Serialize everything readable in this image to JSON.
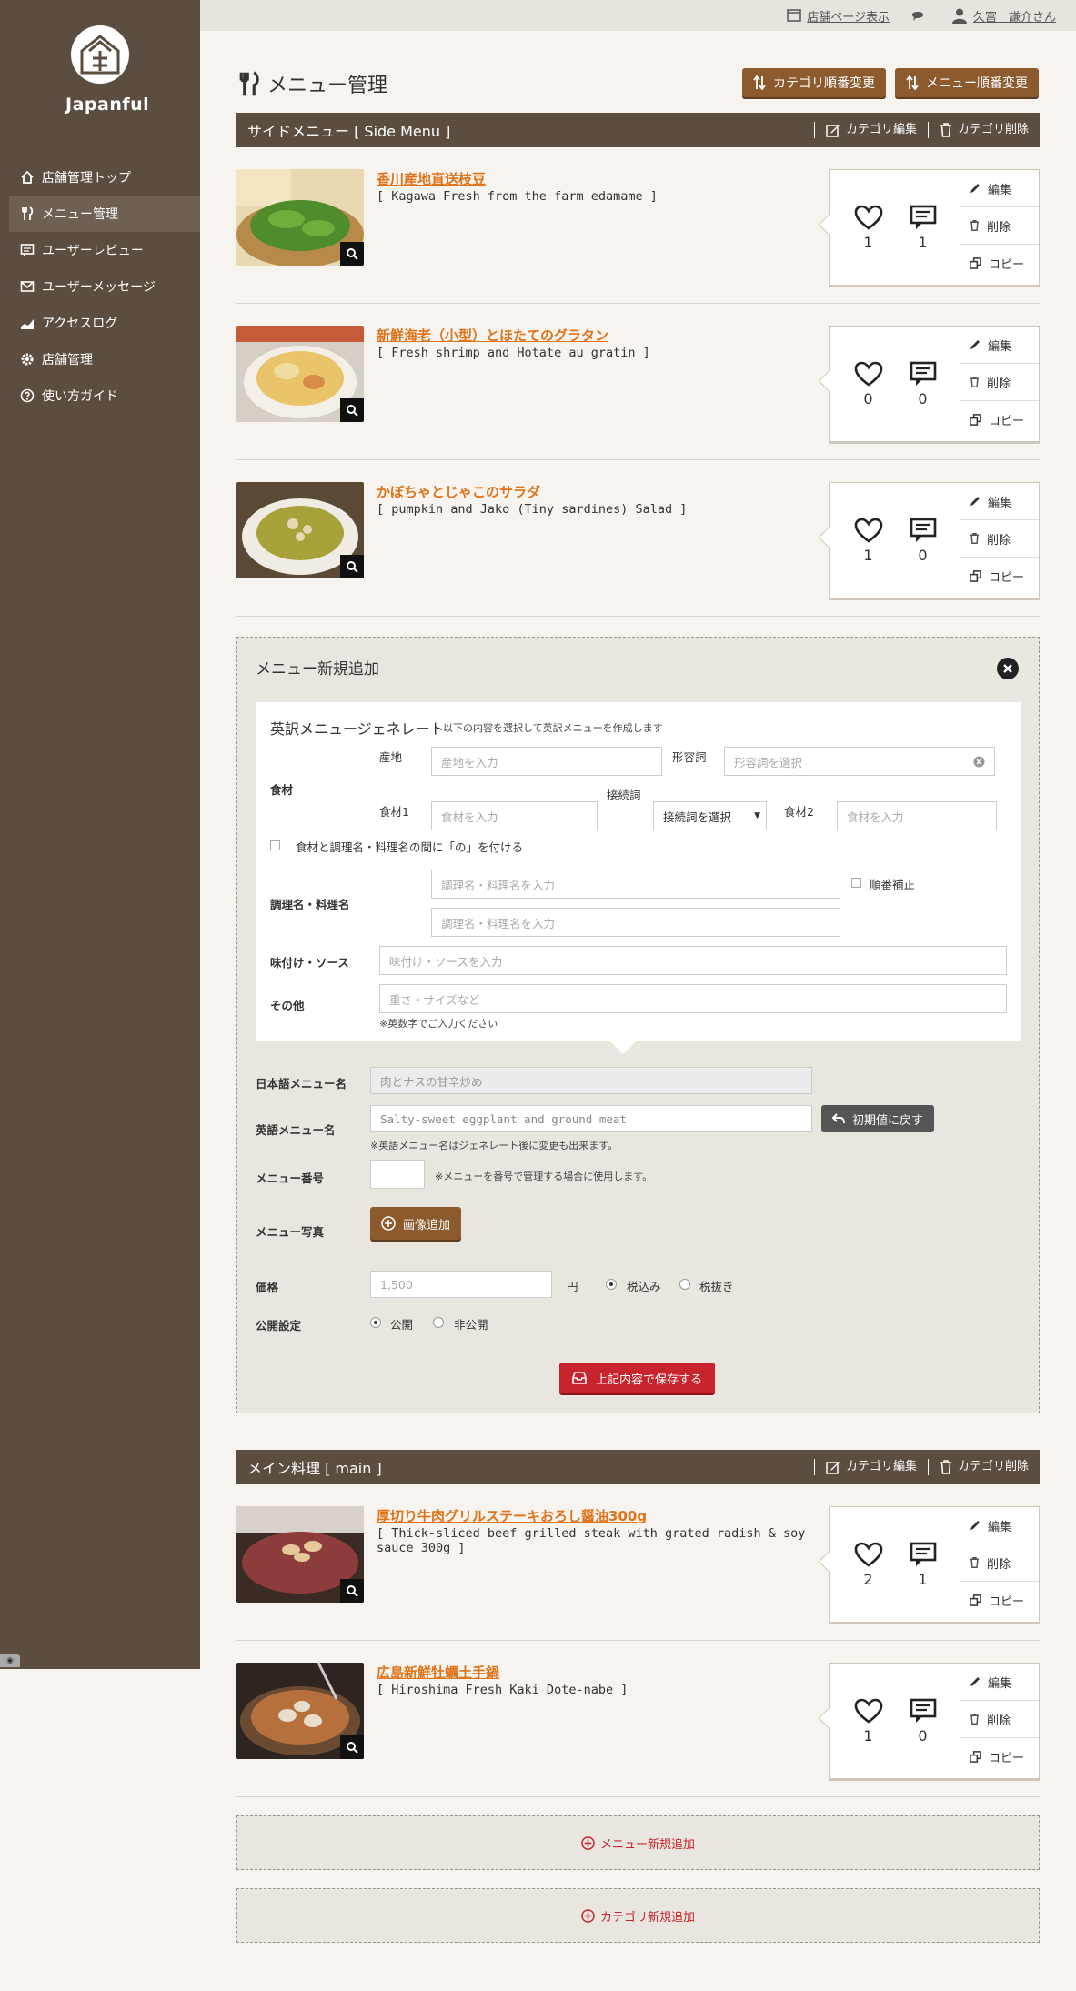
{
  "brand": {
    "name": "Japanful"
  },
  "sidebar": {
    "items": [
      {
        "label": "店舗管理トップ",
        "icon": "home-icon"
      },
      {
        "label": "メニュー管理",
        "icon": "fork-knife-icon",
        "active": true
      },
      {
        "label": "ユーザーレビュー",
        "icon": "comment-icon"
      },
      {
        "label": "ユーザーメッセージ",
        "icon": "mail-icon"
      },
      {
        "label": "アクセスログ",
        "icon": "chart-icon"
      },
      {
        "label": "店舗管理",
        "icon": "gear-icon"
      },
      {
        "label": "使い方ガイド",
        "icon": "help-icon"
      }
    ]
  },
  "topbar": {
    "store_page": "店舗ページ表示",
    "user": "久富　謙介さん"
  },
  "page": {
    "title": "メニュー管理",
    "btn_category_order": "カテゴリ順番変更",
    "btn_menu_order": "メニュー順番変更"
  },
  "category_tools": {
    "edit": "カテゴリ編集",
    "delete": "カテゴリ削除"
  },
  "item_actions": {
    "edit": "編集",
    "delete": "削除",
    "copy": "コピー"
  },
  "categories": [
    {
      "title": "サイドメニュー [ Side Menu ]",
      "items": [
        {
          "name": "香川産地直送枝豆",
          "en": "[ Kagawa Fresh from the farm edamame ]",
          "likes": "1",
          "comments": "1"
        },
        {
          "name": "新鮮海老（小型）とほたてのグラタン",
          "en": "[ Fresh shrimp and Hotate au gratin ]",
          "likes": "0",
          "comments": "0"
        },
        {
          "name": "かぼちゃとじゃこのサラダ",
          "en": "[ pumpkin and Jako (Tiny sardines) Salad ]",
          "likes": "1",
          "comments": "0"
        }
      ]
    },
    {
      "title": "メイン料理 [ main ]",
      "items": [
        {
          "name": "厚切り牛肉グリルステーキおろし醤油300g",
          "en": "[ Thick-sliced beef grilled steak with grated radish & soy sauce 300g ]",
          "likes": "2",
          "comments": "1"
        },
        {
          "name": "広島新鮮牡蠣土手鍋",
          "en": "[ Hiroshima Fresh Kaki Dote-nabe ]",
          "likes": "1",
          "comments": "0"
        }
      ]
    }
  ],
  "new_menu": {
    "title": "メニュー新規追加",
    "generator": {
      "title": "英訳メニュージェネレート",
      "subtitle": "以下の内容を選択して英訳メニューを作成します",
      "ingredients_label": "食材",
      "origin_label": "産地",
      "origin_placeholder": "産地を入力",
      "adjective_label": "形容詞",
      "adjective_placeholder": "形容詞を選択",
      "ingredient1_label": "食材1",
      "ingredient1_placeholder": "食材を入力",
      "conjunction_label": "接続詞",
      "conjunction_selected": "接続詞を選択",
      "ingredient2_label": "食材2",
      "ingredient2_placeholder": "食材を入力",
      "no_checkbox_label": "食材と調理名・料理名の間に「の」を付ける",
      "cooking_label": "調理名・料理名",
      "cooking_placeholder_1": "調理名・料理名を入力",
      "cooking_placeholder_2": "調理名・料理名を入力",
      "order_fix_label": "順番補正",
      "sauce_label": "味付け・ソース",
      "sauce_placeholder": "味付け・ソースを入力",
      "other_label": "その他",
      "other_placeholder": "重さ・サイズなど",
      "other_note": "※英数字でご入力ください"
    },
    "jp_name_label": "日本語メニュー名",
    "jp_name_placeholder": "肉とナスの甘辛炒め",
    "en_name_label": "英語メニュー名",
    "en_name_value": "Salty-sweet eggplant and ground meat",
    "reset_button": "初期値に戻す",
    "en_name_note": "※英語メニュー名はジェネレート後に変更も出来ます。",
    "number_label": "メニュー番号",
    "number_note": "※メニューを番号で管理する場合に使用します。",
    "photo_label": "メニュー写真",
    "photo_button": "画像追加",
    "price_label": "価格",
    "price_placeholder": "1,500",
    "price_unit": "円",
    "tax_included": "税込み",
    "tax_excluded": "税抜き",
    "publish_label": "公開設定",
    "publish_public": "公開",
    "publish_private": "非公開",
    "save_button": "上記内容で保存する"
  },
  "bottom": {
    "add_menu": "メニュー新規追加",
    "add_category": "カテゴリ新規追加"
  },
  "colors": {
    "sidebar": "#5b4d40",
    "accent_brown": "#8c5a2d",
    "link_orange": "#e0731a",
    "save_red": "#c8242d"
  }
}
